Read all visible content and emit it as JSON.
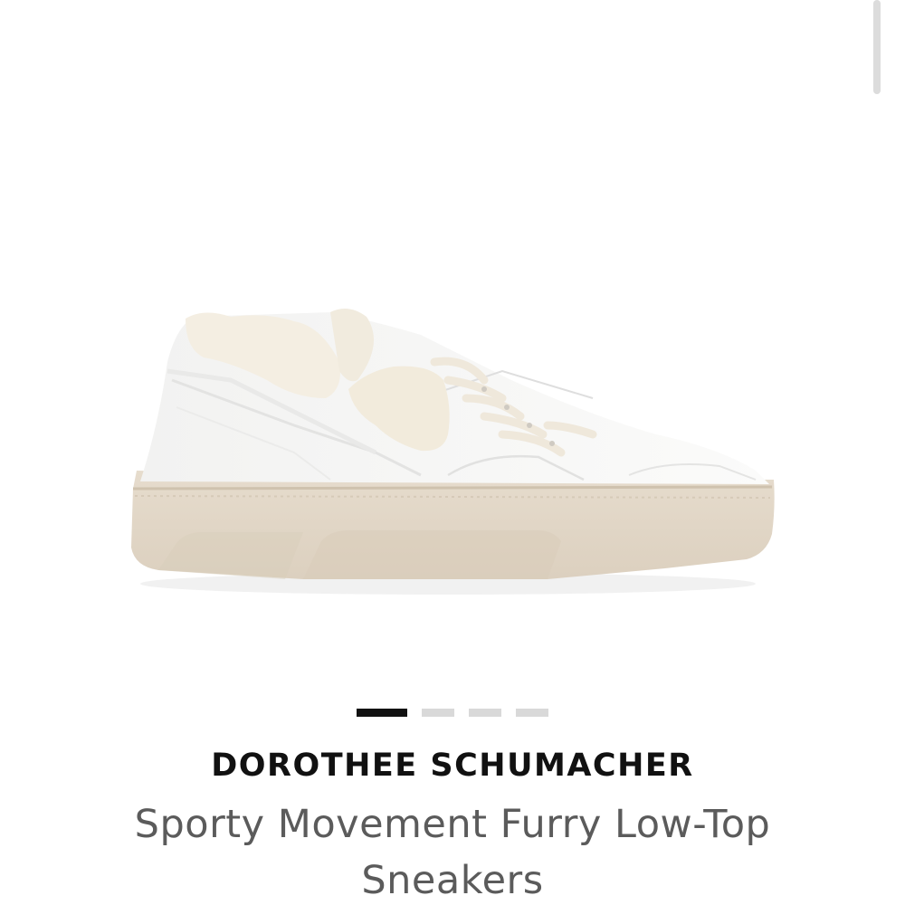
{
  "product": {
    "brand": "DOROTHEE SCHUMACHER",
    "name": "Sporty Movement Furry Low-Top Sneakers",
    "image_icon": "sneaker-product-photo"
  },
  "gallery": {
    "dots": [
      "image 1",
      "image 2",
      "image 3",
      "image 4"
    ],
    "active_index": 0
  },
  "colors": {
    "sole": "#e2d7c8",
    "upper": "#f7f7f6",
    "fur": "#f3ede0",
    "active_dot": "#111111",
    "inactive_dot": "#d9d9d9"
  }
}
